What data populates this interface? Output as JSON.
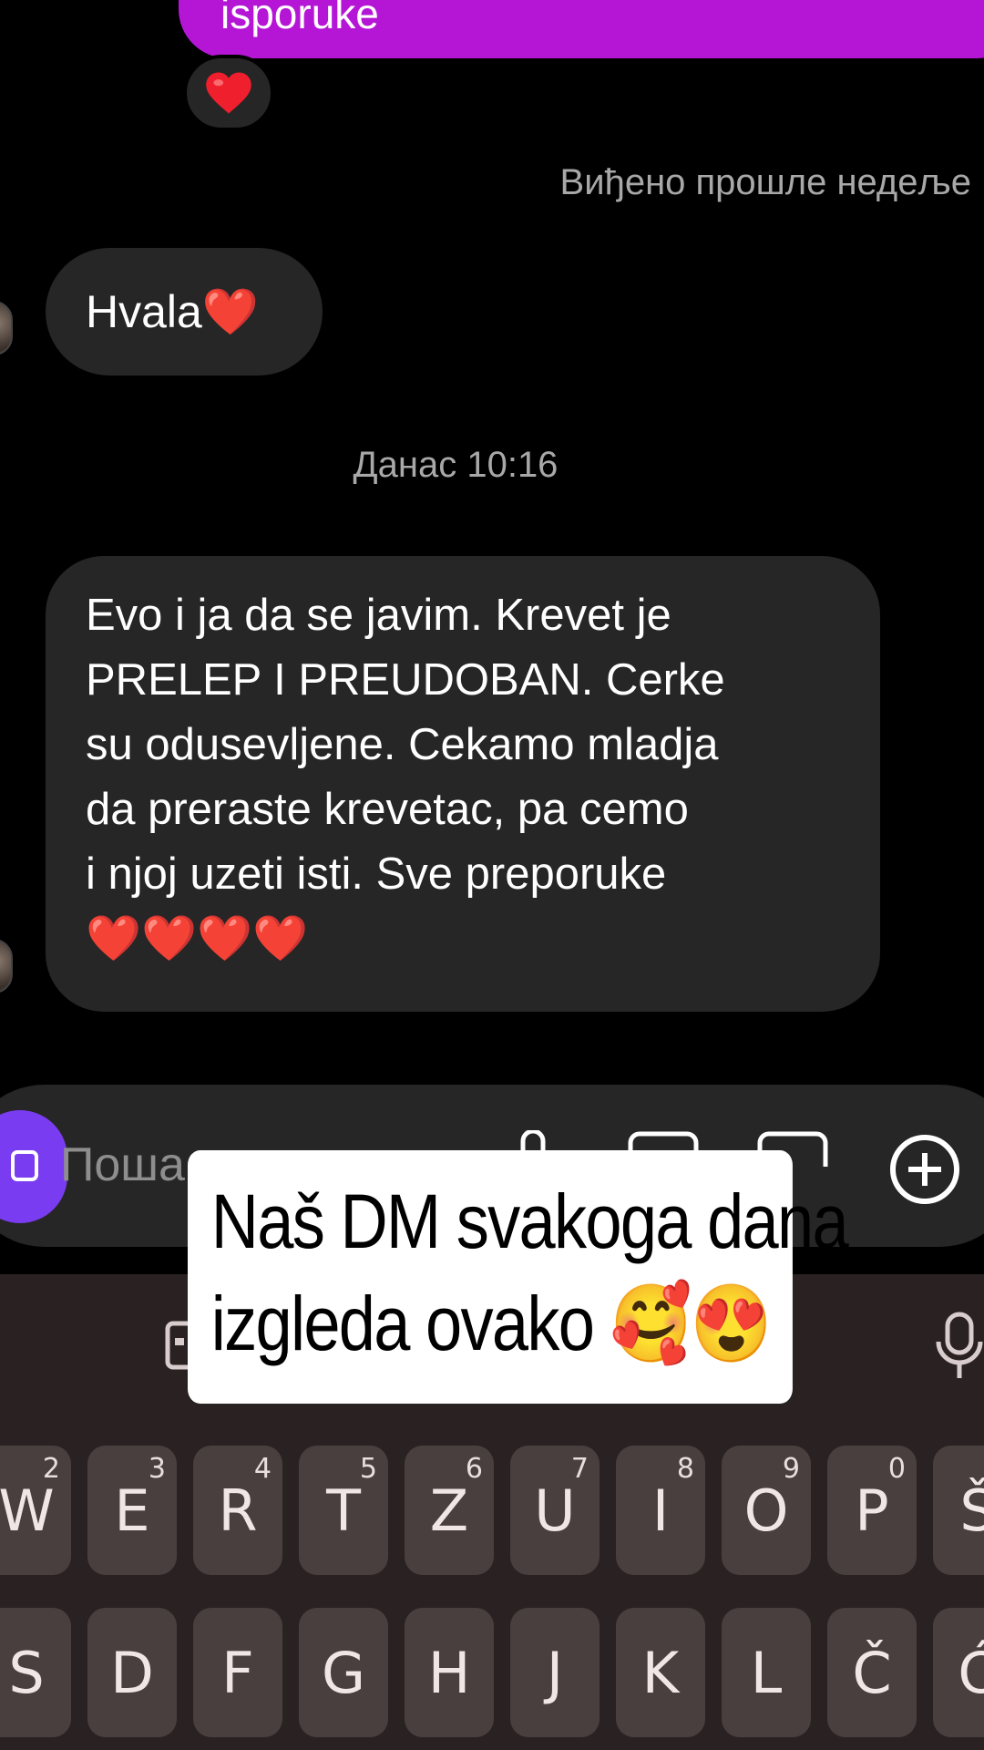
{
  "sent_message": {
    "text": "isporuke"
  },
  "reaction": {
    "emoji": "❤️"
  },
  "seen_status": "Виђено прошле недеље",
  "messages": {
    "short": {
      "text": "Hvala❤️"
    },
    "timestamp": "Данас 10:16",
    "long": {
      "lines": [
        "Evo i ja da se javim. Krevet je",
        "PRELEP I PREUDOBAN. Cerke",
        "su odusevljene. Cekamo mladja",
        "da preraste krevetac, pa cemo",
        "i njoj uzeti isti.  Sve preporuke"
      ],
      "hearts": "❤️❤️❤️❤️"
    }
  },
  "composer": {
    "placeholder": "Поша",
    "icons": [
      "camera-icon",
      "microphone-icon",
      "gallery-icon",
      "sticker-icon",
      "plus-icon"
    ]
  },
  "caption": {
    "line1": "Naš DM svakoga dana",
    "line2": "izgleda ovako 🥰😍"
  },
  "keyboard": {
    "row1": [
      {
        "label": "W",
        "hint": "2"
      },
      {
        "label": "E",
        "hint": "3"
      },
      {
        "label": "R",
        "hint": "4"
      },
      {
        "label": "T",
        "hint": "5"
      },
      {
        "label": "Z",
        "hint": "6"
      },
      {
        "label": "U",
        "hint": "7"
      },
      {
        "label": "I",
        "hint": "8"
      },
      {
        "label": "O",
        "hint": "9"
      },
      {
        "label": "P",
        "hint": "0"
      },
      {
        "label": "Š",
        "hint": ""
      }
    ],
    "row2": [
      "S",
      "D",
      "F",
      "G",
      "H",
      "J",
      "K",
      "L",
      "Č",
      "Ć"
    ],
    "icons": [
      "clipboard-icon",
      "microphone-icon"
    ]
  },
  "colors": {
    "background": "#000000",
    "sent_bubble": "#b516d6",
    "received_bubble": "#262626",
    "keyboard_bg": "#2a2222",
    "key_bg": "#4a3f3f",
    "accent_camera": "#7a3cf0"
  }
}
